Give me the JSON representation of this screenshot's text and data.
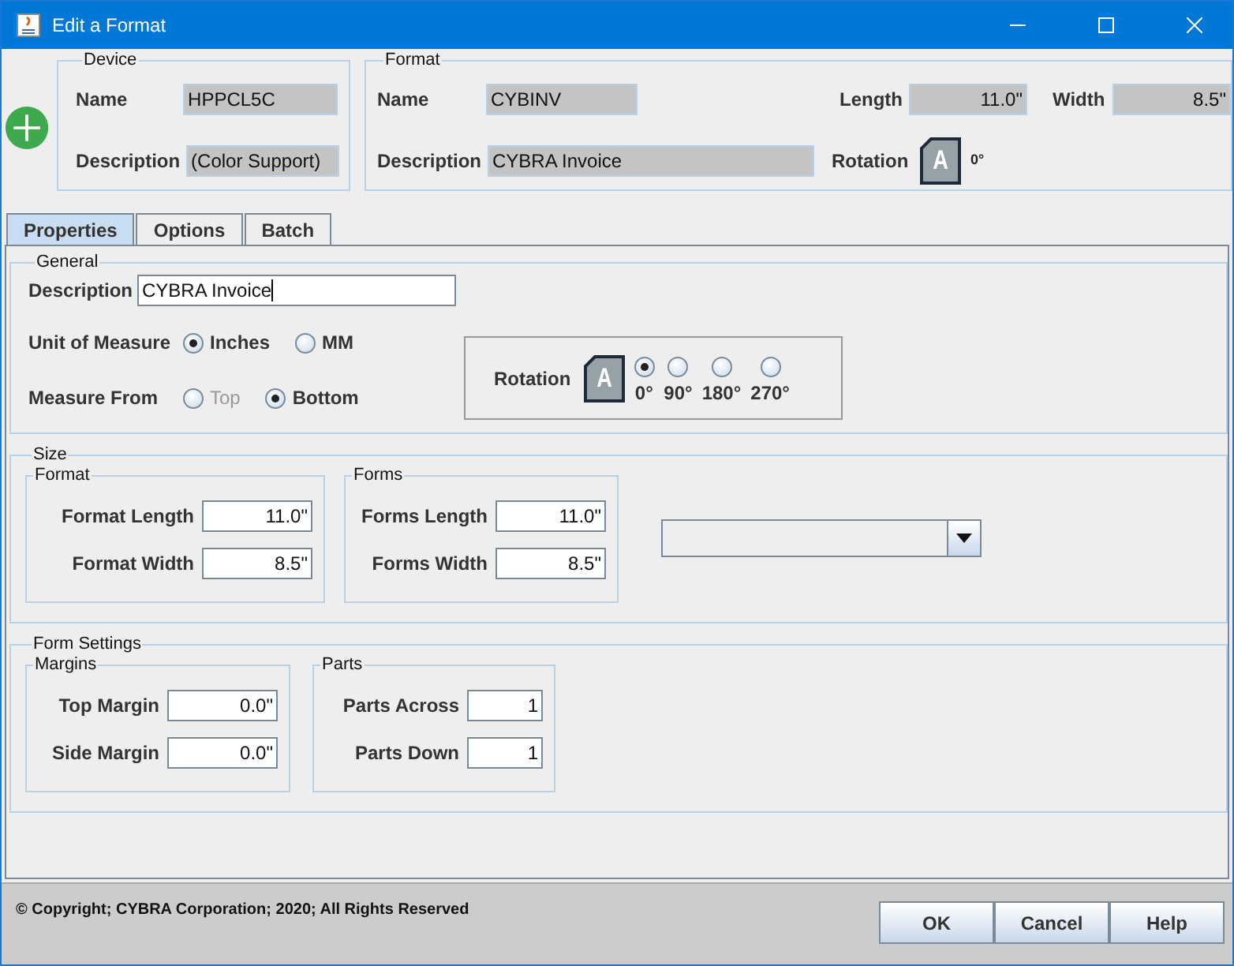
{
  "window": {
    "title": "Edit a Format"
  },
  "device": {
    "legend": "Device",
    "name": {
      "label": "Name",
      "value": "HPPCL5C"
    },
    "description": {
      "label": "Description",
      "value": "(Color Support)"
    }
  },
  "format": {
    "legend": "Format",
    "name": {
      "label": "Name",
      "value": "CYBINV"
    },
    "length": {
      "label": "Length",
      "value": "11.0\""
    },
    "width": {
      "label": "Width",
      "value": "8.5\""
    },
    "description": {
      "label": "Description",
      "value": "CYBRA Invoice"
    },
    "rotation": {
      "label": "Rotation",
      "badge": "A",
      "value": "0°"
    }
  },
  "tabs": [
    {
      "label": "Properties",
      "selected": true
    },
    {
      "label": "Options",
      "selected": false
    },
    {
      "label": "Batch",
      "selected": false
    }
  ],
  "general": {
    "legend": "General",
    "description": {
      "label": "Description",
      "value": "CYBRA Invoice"
    },
    "unit": {
      "label": "Unit of Measure",
      "options": [
        {
          "label": "Inches",
          "selected": true,
          "disabled": false
        },
        {
          "label": "MM",
          "selected": false,
          "disabled": false
        }
      ]
    },
    "measure_from": {
      "label": "Measure From",
      "options": [
        {
          "label": "Top",
          "selected": false,
          "disabled": true
        },
        {
          "label": "Bottom",
          "selected": true,
          "disabled": false
        }
      ]
    },
    "rotation": {
      "label": "Rotation",
      "badge": "A",
      "options": [
        {
          "label": "0°",
          "selected": true
        },
        {
          "label": "90°",
          "selected": false
        },
        {
          "label": "180°",
          "selected": false
        },
        {
          "label": "270°",
          "selected": false
        }
      ]
    }
  },
  "size": {
    "legend": "Size",
    "groups": [
      {
        "legend": "Format",
        "fields": [
          {
            "label": "Format Length",
            "value": "11.0\""
          },
          {
            "label": "Format Width",
            "value": "8.5\""
          }
        ]
      },
      {
        "legend": "Forms",
        "fields": [
          {
            "label": "Forms Length",
            "value": "11.0\""
          },
          {
            "label": "Forms Width",
            "value": "8.5\""
          }
        ]
      }
    ]
  },
  "form_settings": {
    "legend": "Form Settings",
    "groups": [
      {
        "legend": "Margins",
        "fields": [
          {
            "label": "Top Margin",
            "value": "0.0\""
          },
          {
            "label": "Side Margin",
            "value": "0.0\""
          }
        ]
      },
      {
        "legend": "Parts",
        "fields": [
          {
            "label": "Parts Across",
            "value": "1"
          },
          {
            "label": "Parts Down",
            "value": "1"
          }
        ]
      }
    ]
  },
  "footer": {
    "copyright": "© Copyright; CYBRA Corporation; 2020; All Rights Reserved",
    "buttons": [
      "OK",
      "Cancel",
      "Help"
    ]
  }
}
